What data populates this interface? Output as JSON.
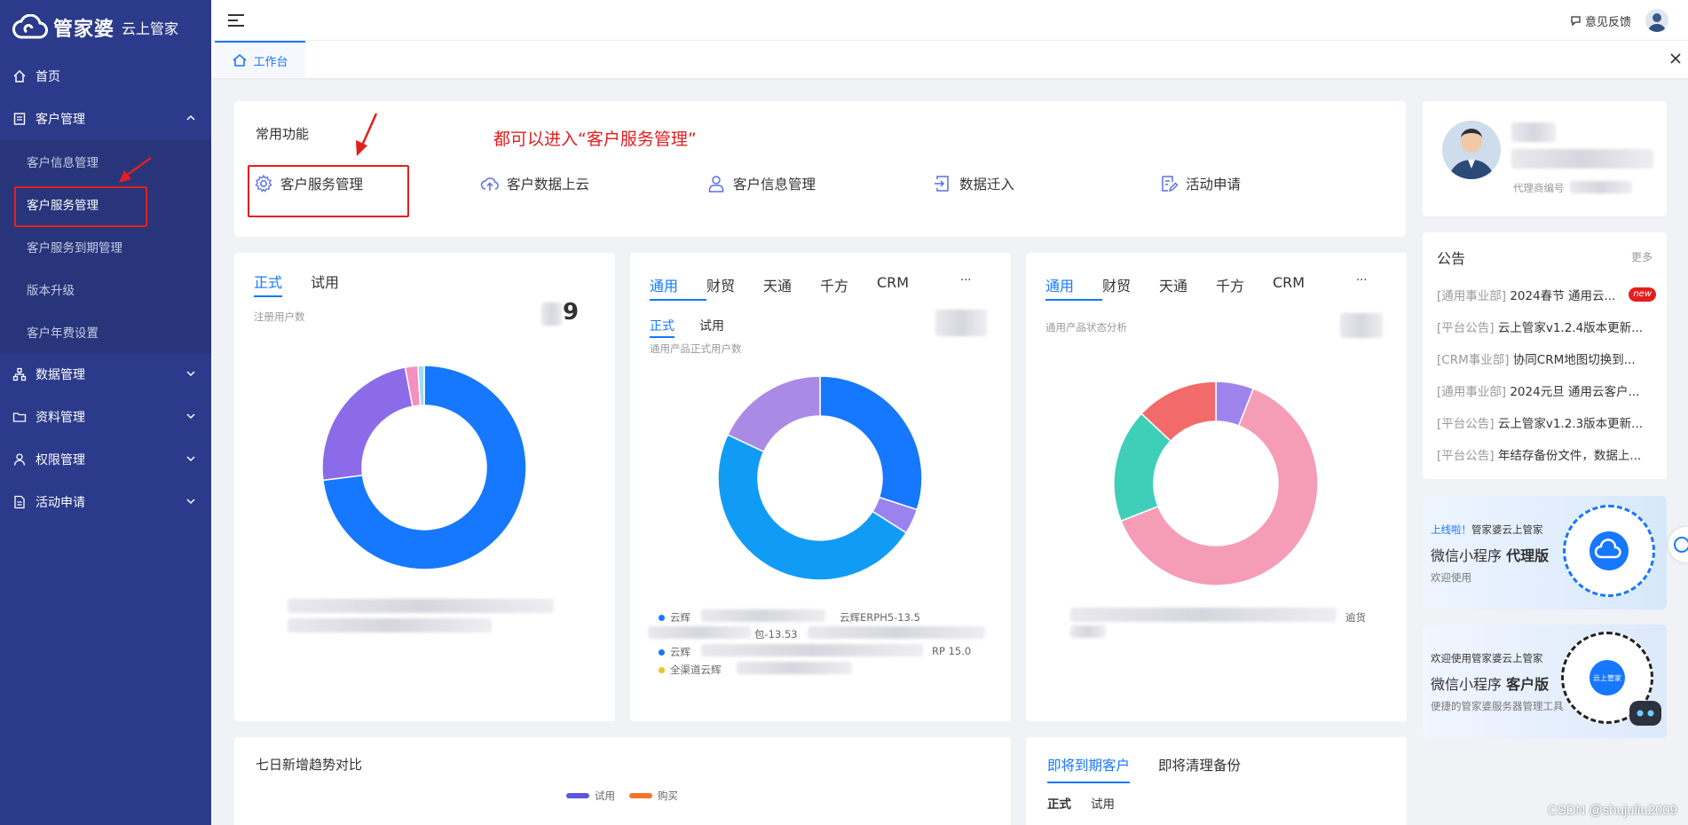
{
  "logo": {
    "main": "管家婆",
    "sub": "云上管家"
  },
  "sidebar": {
    "items": [
      {
        "label": "首页"
      },
      {
        "label": "客户管理"
      },
      {
        "label": "数据管理"
      },
      {
        "label": "资料管理"
      },
      {
        "label": "权限管理"
      },
      {
        "label": "活动申请"
      }
    ],
    "submenu": [
      {
        "label": "客户信息管理"
      },
      {
        "label": "客户服务管理"
      },
      {
        "label": "客户服务到期管理"
      },
      {
        "label": "版本升级"
      },
      {
        "label": "客户年费设置"
      }
    ]
  },
  "header": {
    "feedback": "意见反馈"
  },
  "tabbar": {
    "tab": "工作台"
  },
  "common": {
    "title": "常用功能",
    "annotation": "都可以进入“客户服务管理”",
    "functions": [
      {
        "label": "客户服务管理",
        "icon": "gear-icon"
      },
      {
        "label": "客户数据上云",
        "icon": "cloud-upload-icon"
      },
      {
        "label": "客户信息管理",
        "icon": "user-icon"
      },
      {
        "label": "数据迁入",
        "icon": "import-icon"
      },
      {
        "label": "活动申请",
        "icon": "edit-icon"
      }
    ]
  },
  "profile": {
    "agent_label": "代理商编号"
  },
  "notice": {
    "title": "公告",
    "more": "更多",
    "new_badge": "new",
    "items": [
      {
        "tag": "[通用事业部]",
        "text": "2024春节 通用云..."
      },
      {
        "tag": "[平台公告]",
        "text": "云上管家v1.2.4版本更新..."
      },
      {
        "tag": "[CRM事业部]",
        "text": "协同CRM地图切换到..."
      },
      {
        "tag": "[通用事业部]",
        "text": "2024元旦 通用云客户..."
      },
      {
        "tag": "[平台公告]",
        "text": "云上管家v1.2.3版本更新..."
      },
      {
        "tag": "[平台公告]",
        "text": "年结存备份文件，数据上..."
      }
    ]
  },
  "banner1": {
    "prefix": "上线啦！",
    "brand": "管家婆云上管家",
    "line1": "微信小程序",
    "line1b": "代理版",
    "line2": "欢迎使用"
  },
  "banner2": {
    "top": "欢迎使用管家婆云上管家",
    "line1": "微信小程序",
    "line1b": "客户版",
    "line2": "便捷的管家婆服务器管理工具",
    "qr_label": "云上管家"
  },
  "card1": {
    "tabs": [
      "正式",
      "试用"
    ],
    "label": "注册用户数",
    "num_suffix": "9"
  },
  "card2": {
    "tabs": [
      "通用",
      "财贸",
      "天通",
      "千方",
      "CRM",
      "···"
    ],
    "subtabs": [
      "正式",
      "试用"
    ],
    "label": "通用产品正式用户数",
    "legend_a": "云辉",
    "legend_b": "云辉ERPH5-13.5",
    "legend_c": "包-13.53",
    "legend_d": "云辉",
    "legend_e": "RP 15.0",
    "legend_f": "全渠道云辉"
  },
  "card3": {
    "tabs": [
      "通用",
      "财贸",
      "天通",
      "千方",
      "CRM",
      "···"
    ],
    "label": "通用产品状态分析",
    "legend_end": "逾货"
  },
  "trend": {
    "title": "七日新增趋势对比",
    "legend": [
      "试用",
      "购买"
    ]
  },
  "expire": {
    "tabs": [
      "即将到期客户",
      "即将清理备份"
    ],
    "subtabs": [
      "正式",
      "试用"
    ]
  },
  "watermark": "CSDN @shujuliu2009",
  "chart_data": [
    {
      "type": "pie",
      "values": [
        73,
        24,
        2,
        1
      ],
      "colors": [
        "#1677ff",
        "#8c6be8",
        "#f58ec1",
        "#9fdcf0"
      ]
    },
    {
      "type": "pie",
      "values": [
        30,
        4,
        48,
        18
      ],
      "colors": [
        "#1677ff",
        "#9c82ee",
        "#109cf5",
        "#a98be6"
      ]
    },
    {
      "type": "pie",
      "values": [
        6,
        63,
        18,
        13
      ],
      "colors": [
        "#9f84ee",
        "#f59cb6",
        "#3fcfb9",
        "#f26a6a"
      ]
    }
  ],
  "colors": {
    "sidebar": "#2b3a8a",
    "accent": "#1677ff",
    "highlight": "#e41e1e"
  }
}
